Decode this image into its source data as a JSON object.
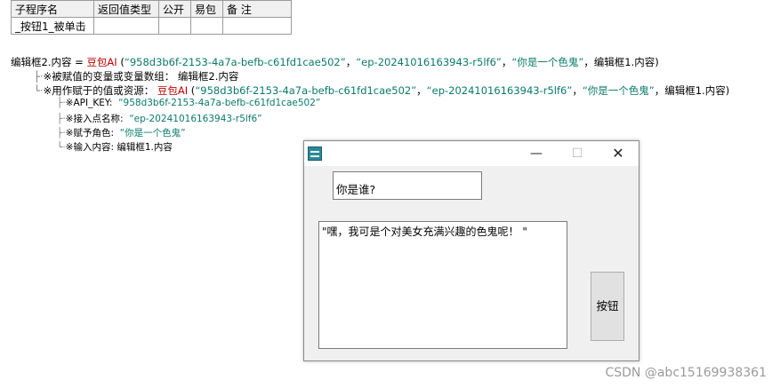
{
  "table": {
    "headers": [
      "子程序名",
      "返回值类型",
      "公开",
      "易包",
      "备 注"
    ],
    "row": [
      "_按钮1_被单击",
      "",
      "",
      "",
      ""
    ]
  },
  "code": {
    "main": {
      "target": "编辑框2.内容",
      "op": " = ",
      "func": "豆包AI",
      "open": " (",
      "arg1": "“958d3b6f-2153-4a7a-befb-c61fd1cae502”",
      "sep1": "，",
      "arg2": "“ep-20241016163943-r5lf6”",
      "sep2": "，",
      "arg3": "“你是一个色鬼”",
      "sep3": "，",
      "arg4": "编辑框1.内容)"
    },
    "param_a": {
      "tree": "├·",
      "label": "※被赋值的变量或变量数组：",
      "value": " 编辑框2.内容"
    },
    "param_b": {
      "tree": "└·",
      "label": "※用作赋于的值或资源：",
      "func": " 豆包AI",
      "open": " (",
      "arg1": "“958d3b6f-2153-4a7a-befb-c61fd1cae502”",
      "sep1": "，",
      "arg2": "“ep-20241016163943-r5lf6”",
      "sep2": "，",
      "arg3": "“你是一个色鬼”",
      "sep3": "，",
      "arg4": "编辑框1.内容)"
    },
    "param_c": {
      "tree": "├·",
      "label": "※API_KEY:",
      "value": "“958d3b6f-2153-4a7a-befb-c61fd1cae502”"
    },
    "param_d": {
      "tree": "├·",
      "label": "※接入点名称:",
      "value": "“ep-20241016163943-r5lf6”"
    },
    "param_e": {
      "tree": "├·",
      "label": "※赋予角色:",
      "value": "“你是一个色鬼”"
    },
    "param_f": {
      "tree": "└·",
      "label": "※输入内容:",
      "value": " 编辑框1.内容"
    }
  },
  "window": {
    "minimize_glyph": "—",
    "maximize_glyph": "☐",
    "close_glyph": "✕",
    "input_value": "你是谁?",
    "output_value": "\"嘿，我可是个对美女充满兴趣的色鬼呢！ \"",
    "button_label": "按钮"
  },
  "watermark": "CSDN @abc15169938361",
  "colors": {
    "function_red": "#c00000",
    "string_teal": "#0a7a6a"
  },
  "icons": [
    "app-icon",
    "minimize-icon",
    "maximize-icon",
    "close-icon"
  ]
}
